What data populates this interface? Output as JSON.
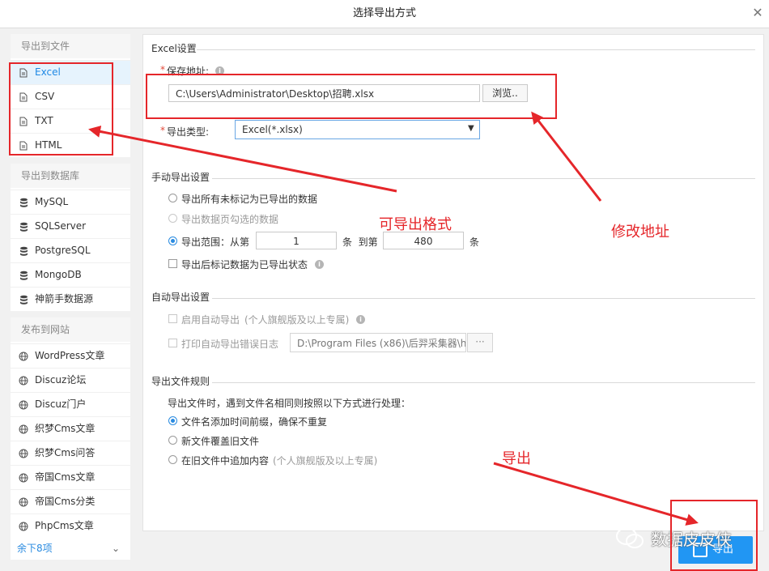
{
  "dialog": {
    "title": "选择导出方式",
    "close_icon": "close-icon"
  },
  "sidebar": {
    "groups": [
      {
        "title": "导出到文件",
        "items": [
          {
            "label": "Excel",
            "icon": "file-icon",
            "active": true
          },
          {
            "label": "CSV",
            "icon": "file-icon"
          },
          {
            "label": "TXT",
            "icon": "file-icon"
          },
          {
            "label": "HTML",
            "icon": "file-icon"
          }
        ]
      },
      {
        "title": "导出到数据库",
        "items": [
          {
            "label": "MySQL",
            "icon": "database-icon"
          },
          {
            "label": "SQLServer",
            "icon": "database-icon"
          },
          {
            "label": "PostgreSQL",
            "icon": "database-icon"
          },
          {
            "label": "MongoDB",
            "icon": "database-icon"
          },
          {
            "label": "神箭手数据源",
            "icon": "database-icon"
          }
        ]
      },
      {
        "title": "发布到网站",
        "items": [
          {
            "label": "WordPress文章",
            "icon": "globe-icon"
          },
          {
            "label": "Discuz论坛",
            "icon": "globe-icon"
          },
          {
            "label": "Discuz门户",
            "icon": "globe-icon"
          },
          {
            "label": "织梦Cms文章",
            "icon": "globe-icon"
          },
          {
            "label": "织梦Cms问答",
            "icon": "globe-icon"
          },
          {
            "label": "帝国Cms文章",
            "icon": "globe-icon"
          },
          {
            "label": "帝国Cms分类",
            "icon": "globe-icon"
          },
          {
            "label": "PhpCms文章",
            "icon": "globe-icon"
          }
        ]
      }
    ],
    "more_label": "余下8项"
  },
  "excel_settings": {
    "section_title": "Excel设置",
    "save_path_label": "保存地址:",
    "save_path_value": "C:\\Users\\Administrator\\Desktop\\招聘.xlsx",
    "browse_label": "浏览..",
    "type_label": "导出类型:",
    "type_value": "Excel(*.xlsx)"
  },
  "manual_export": {
    "section_title": "手动导出设置",
    "opt_all": "导出所有未标记为已导出的数据",
    "opt_selected": "导出数据页勾选的数据",
    "opt_range": "导出范围：从第",
    "range_from": "1",
    "range_mid": "条  到第",
    "range_to": "480",
    "range_end": "条",
    "mark_exported": "导出后标记数据为已导出状态"
  },
  "auto_export": {
    "section_title": "自动导出设置",
    "enable_label": "启用自动导出",
    "enable_note": "(个人旗舰版及以上专属)",
    "log_label": "打印自动导出错误日志",
    "log_path": "D:\\Program Files (x86)\\后羿采集器\\ho",
    "log_browse": "···"
  },
  "file_rules": {
    "section_title": "导出文件规则",
    "desc": "导出文件时，遇到文件名相同则按照以下方式进行处理：",
    "opt_prefix": "文件名添加时间前缀，确保不重复",
    "opt_overwrite": "新文件覆盖旧文件",
    "opt_append": "在旧文件中追加内容",
    "opt_append_note": "(个人旗舰版及以上专属)"
  },
  "annotations": {
    "formats": "可导出格式",
    "modify_path": "修改地址",
    "export": "导出"
  },
  "export_button": {
    "label": "导出",
    "icon": "export-icon"
  },
  "watermark": {
    "text": "数据皮皮侠",
    "icon": "wechat-icon"
  },
  "colors": {
    "accent": "#2196f3",
    "annotation": "#e5262a"
  }
}
